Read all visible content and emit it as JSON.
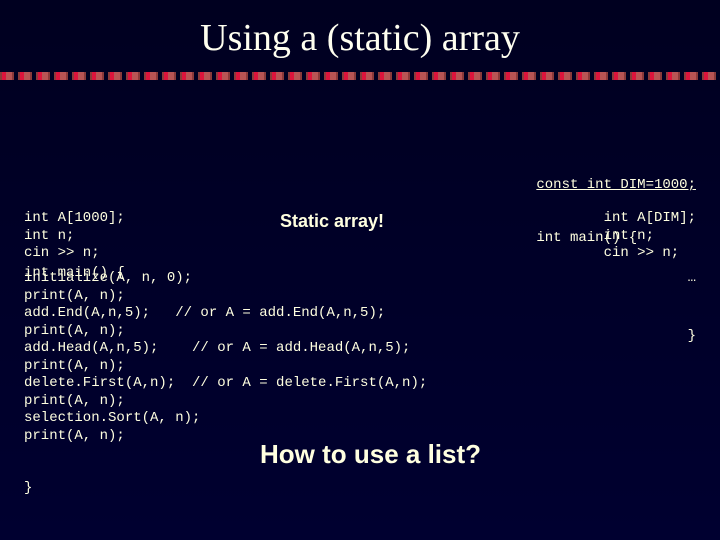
{
  "title": "Using a (static) array",
  "left": {
    "main_open": "int main() {",
    "decl": "int A[1000];\nint n;\ncin >> n;",
    "body": "initialize(A, n, 0);\nprint(A, n);\nadd.End(A,n,5);   // or A = add.End(A,n,5);\nprint(A, n);\nadd.Head(A,n,5);    // or A = add.Head(A,n,5);\nprint(A, n);\ndelete.First(A,n);  // or A = delete.First(A,n);\nprint(A, n);\nselection.Sort(A, n);\nprint(A, n);",
    "close": "}"
  },
  "right": {
    "const_line": "const int DIM=1000;",
    "main_open": "int main() {",
    "decl": "int A[DIM];\nint n;\ncin >> n;",
    "ellipsis": "…",
    "close": "}"
  },
  "labels": {
    "static_array": "Static array!",
    "howto": "How to use a list?"
  }
}
